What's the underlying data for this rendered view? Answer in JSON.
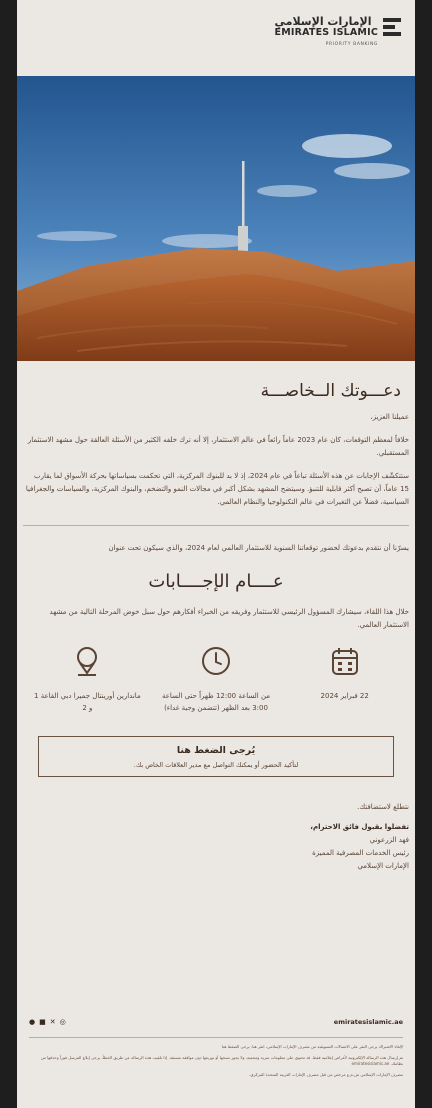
{
  "header": {
    "logo_ar": "الإمارات الإسلامي",
    "logo_en": "EMIRATES ISLAMIC",
    "logo_sub": "PRIORITY BANKING"
  },
  "invite": {
    "title": "دعـــوتك الــخاصـــة",
    "greeting": "عميلنا العزيز،",
    "p1": "خلافاً لمعظم التوقعات، كان عام 2023 عاماً رائعاً في عالم الاستثمار، إلا أنه ترك خلفه الكثير من الأسئلة العالقة حول مشهد الاستثمار المستقبلي.",
    "p2": "ستتكشّف الإجابات عن هذه الأسئلة تباعاً في عام 2024، إذ لا بد للبنوك المركزية، التي تحكمت بسياساتها بحركة الأسواق لما يقارب 15 عاماً، أن تصبح أكثر قابلية للتنبؤ. وسيتضح المشهد بشكل أكبر في مجالات النمو والتضخم، والبنوك المركزية، والسياسات والجغرافيا السياسية، فضلاً عن التغيرات في عالم التكنولوجيا والنظام العالمي.",
    "p3": "يسرّنا أن نتقدم بدعوتك لحضور توقعاتنا السنوية للاستثمار العالمي لعام 2024، والذي سيكون تحت عنوان",
    "event_title": "عــــام الإجــــابات",
    "p4": "خلال هذا اللقاء، سيشارك المسؤول الرئيسي للاستثمار وفريقه من الخبراء أفكارهم حول سبل خوض المرحلة التالية من مشهد الاستثمار العالمي."
  },
  "details": [
    {
      "icon": "calendar-icon",
      "text": "22 فبراير 2024"
    },
    {
      "icon": "clock-icon",
      "text": "من الساعة 12:00 ظهراً حتى الساعة 3:00 بعد الظهر (تتضمن وجبة غداء)"
    },
    {
      "icon": "location-icon",
      "text": "ماندارين أورينتال جميرا دبي القاعة 1 و 2"
    }
  ],
  "cta": {
    "title": "يُرجى الضغط هنا",
    "subtitle": "لتأكيد الحضور أو يمكنك التواصل مع مدير العلاقات الخاص بك."
  },
  "closing": "نتطلع لاستضافتك.",
  "signature": {
    "regards": "تفضلوا بقبول فائق الاحترام،",
    "name": "فهد الزرعوني",
    "role": "رئيس الخدمات المصرفية المميزة",
    "org": "الإمارات الإسلامي"
  },
  "footer": {
    "site": "emiratesislamic.ae",
    "unsubscribe": "لإلغاء الاشتراك يرجى النقر على الاتصالات التسويقية من مصرف الإمارات الإسلامي، انقر هنا. يرجى الضغط هنا",
    "disclaimer": "تم إرسال هذه الرسالة الإلكترونية لأغراض إعلامية فقط. قد تحتوي على معلومات سرية ومحمية، ولا يجوز نسخها أو توزيعها دون موافقة مسبقة. إذا تلقيت هذه الرسالة عن طريق الخطأ، يرجى إبلاغ المرسل فوراً وحذفها من نظامك. emiratesislamic.ae",
    "license": "مصرف الإمارات الإسلامي ش.م.ع مرخص من قبل مصرف الإمارات العربية المتحدة المركزي."
  },
  "colors": {
    "background": "#ebe7e3",
    "text": "#3a2a1e",
    "sand": "#b0602d",
    "sky": "#2f5f95"
  }
}
